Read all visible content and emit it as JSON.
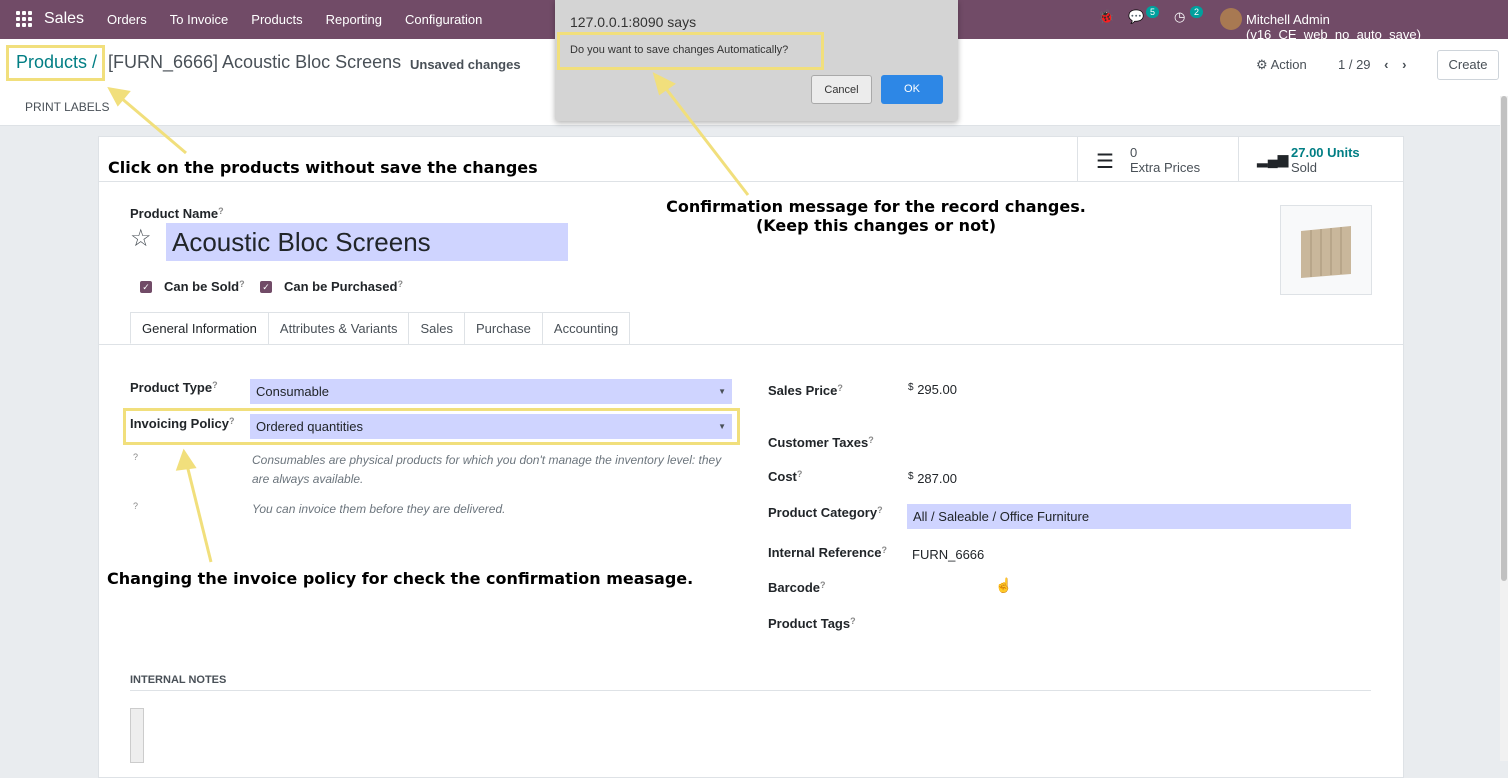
{
  "navbar": {
    "app_name": "Sales",
    "menu": [
      "Orders",
      "To Invoice",
      "Products",
      "Reporting",
      "Configuration"
    ],
    "messages_count": "5",
    "activities_count": "2",
    "user": "Mitchell Admin (v16_CE_web_no_auto_save)"
  },
  "breadcrumb": {
    "root": "Products /",
    "record": "[FURN_6666] Acoustic Bloc Screens",
    "status": "Unsaved changes"
  },
  "controls": {
    "action": "Action",
    "pager": "1 / 29",
    "create": "Create",
    "print_labels": "PRINT LABELS"
  },
  "stats": {
    "extra_prices_value": "0",
    "extra_prices_label": "Extra Prices",
    "sold_value": "27.00 Units",
    "sold_label": "Sold"
  },
  "product": {
    "name_label": "Product Name",
    "name": "Acoustic Bloc Screens",
    "can_be_sold": "Can be Sold",
    "can_be_purchased": "Can be Purchased"
  },
  "tabs": [
    "General Information",
    "Attributes & Variants",
    "Sales",
    "Purchase",
    "Accounting"
  ],
  "general": {
    "product_type_label": "Product Type",
    "product_type": "Consumable",
    "invoicing_policy_label": "Invoicing Policy",
    "invoicing_policy": "Ordered quantities",
    "help_consumable": "Consumables are physical products for which you don't manage the inventory level: they are always available.",
    "help_invoice": "You can invoice them before they are delivered.",
    "sales_price_label": "Sales Price",
    "sales_price": "295.00",
    "currency": "$",
    "customer_taxes_label": "Customer Taxes",
    "cost_label": "Cost",
    "cost": "287.00",
    "category_label": "Product Category",
    "category": "All / Saleable / Office Furniture",
    "internal_ref_label": "Internal Reference",
    "internal_ref": "FURN_6666",
    "barcode_label": "Barcode",
    "tags_label": "Product Tags",
    "internal_notes": "INTERNAL NOTES"
  },
  "dialog": {
    "host": "127.0.0.1:8090 says",
    "message": "Do you want to save changes Automatically?",
    "cancel": "Cancel",
    "ok": "OK"
  },
  "annotations": {
    "note_products": "Click on the products without save the changes",
    "note_confirm_1": "Confirmation message for the record changes.",
    "note_confirm_2": "(Keep this changes or not)",
    "note_policy": "Changing the invoice policy for check the confirmation measage.",
    "highlight_color": "#f1df7c"
  }
}
